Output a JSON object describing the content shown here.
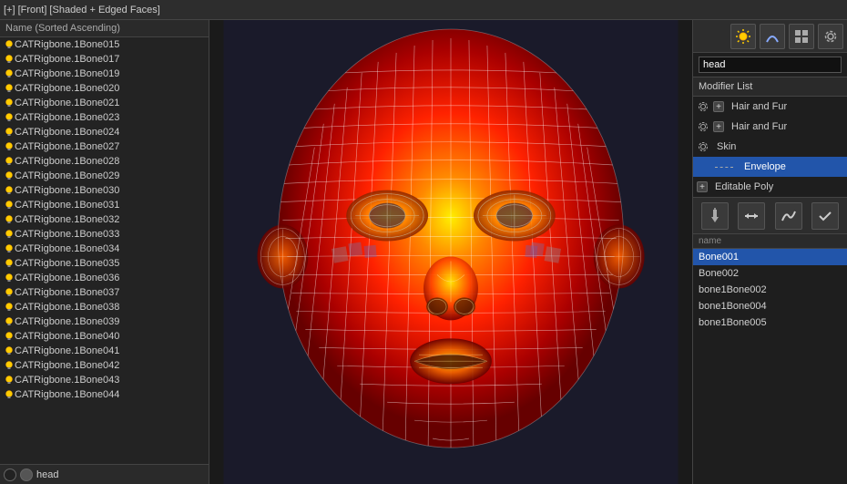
{
  "topbar": {
    "label": "[+] [Front] [Shaded + Edged Faces]"
  },
  "left_panel": {
    "header": "Name (Sorted Ascending)",
    "items": [
      "CATRigbone.1Bone015",
      "CATRigbone.1Bone017",
      "CATRigbone.1Bone019",
      "CATRigbone.1Bone020",
      "CATRigbone.1Bone021",
      "CATRigbone.1Bone023",
      "CATRigbone.1Bone024",
      "CATRigbone.1Bone027",
      "CATRigbone.1Bone028",
      "CATRigbone.1Bone029",
      "CATRigbone.1Bone030",
      "CATRigbone.1Bone031",
      "CATRigbone.1Bone032",
      "CATRigbone.1Bone033",
      "CATRigbone.1Bone034",
      "CATRigbone.1Bone035",
      "CATRigbone.1Bone036",
      "CATRigbone.1Bone037",
      "CATRigbone.1Bone038",
      "CATRigbone.1Bone039",
      "CATRigbone.1Bone040",
      "CATRigbone.1Bone041",
      "CATRigbone.1Bone042",
      "CATRigbone.1Bone043",
      "CATRigbone.1Bone044"
    ],
    "footer_label": "head"
  },
  "right_panel": {
    "name_value": "head",
    "modifier_list_label": "Modifier List",
    "modifiers": [
      {
        "label": "Hair and Fur",
        "icon": "gear",
        "has_plus": true,
        "sub": false
      },
      {
        "label": "Hair and Fur",
        "icon": "gear",
        "has_plus": true,
        "sub": false
      },
      {
        "label": "Skin",
        "icon": "gear",
        "has_plus": false,
        "sub": false
      },
      {
        "label": "Envelope",
        "icon": "dashed",
        "has_plus": false,
        "sub": true,
        "selected": true
      },
      {
        "label": "Editable Poly",
        "icon": "plus_box",
        "has_plus": false,
        "sub": false
      }
    ],
    "bone_list_header": "name",
    "bones": [
      {
        "label": "Bone001",
        "selected": true
      },
      {
        "label": "Bone002",
        "selected": false
      },
      {
        "label": "bone1Bone002",
        "selected": false
      },
      {
        "label": "bone1Bone004",
        "selected": false
      },
      {
        "label": "bone1Bone005",
        "selected": false
      }
    ]
  },
  "icons": {
    "sun": "☀",
    "arrow_left": "◀",
    "arrow_right": "▶",
    "pin": "📌",
    "move": "↔",
    "curve": "∿",
    "checkmark": "✓",
    "plus": "+",
    "minus": "-"
  }
}
